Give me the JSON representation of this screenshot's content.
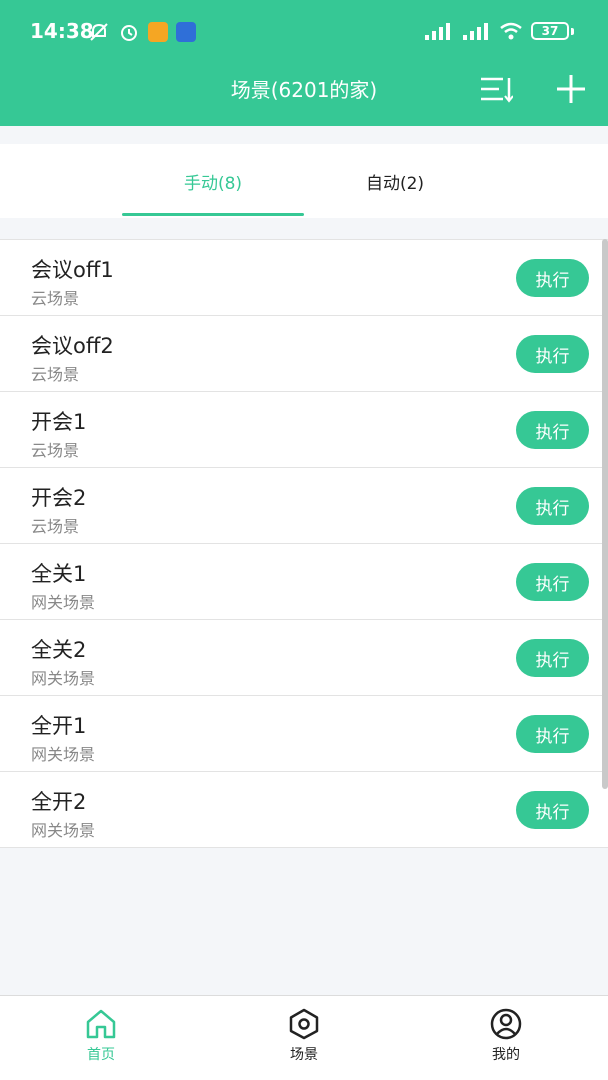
{
  "status_bar": {
    "time": "14:38",
    "battery": "37"
  },
  "header": {
    "title": "场景(6201的家)"
  },
  "tabs": [
    {
      "label": "手动(8)",
      "active": true
    },
    {
      "label": "自动(2)",
      "active": false
    }
  ],
  "scenes": [
    {
      "name": "会议off1",
      "type": "云场景",
      "action": "执行"
    },
    {
      "name": "会议off2",
      "type": "云场景",
      "action": "执行"
    },
    {
      "name": "开会1",
      "type": "云场景",
      "action": "执行"
    },
    {
      "name": "开会2",
      "type": "云场景",
      "action": "执行"
    },
    {
      "name": "全关1",
      "type": "网关场景",
      "action": "执行"
    },
    {
      "name": "全关2",
      "type": "网关场景",
      "action": "执行"
    },
    {
      "name": "全开1",
      "type": "网关场景",
      "action": "执行"
    },
    {
      "name": "全开2",
      "type": "网关场景",
      "action": "执行"
    }
  ],
  "bottom_nav": [
    {
      "label": "首页",
      "icon": "home-icon",
      "active": true
    },
    {
      "label": "场景",
      "icon": "hexagon-scene-icon",
      "active": false
    },
    {
      "label": "我的",
      "icon": "user-profile-icon",
      "active": false
    }
  ],
  "colors": {
    "accent": "#36c895",
    "text": "#222222",
    "subtext": "#888888",
    "background": "#f4f6f9"
  }
}
